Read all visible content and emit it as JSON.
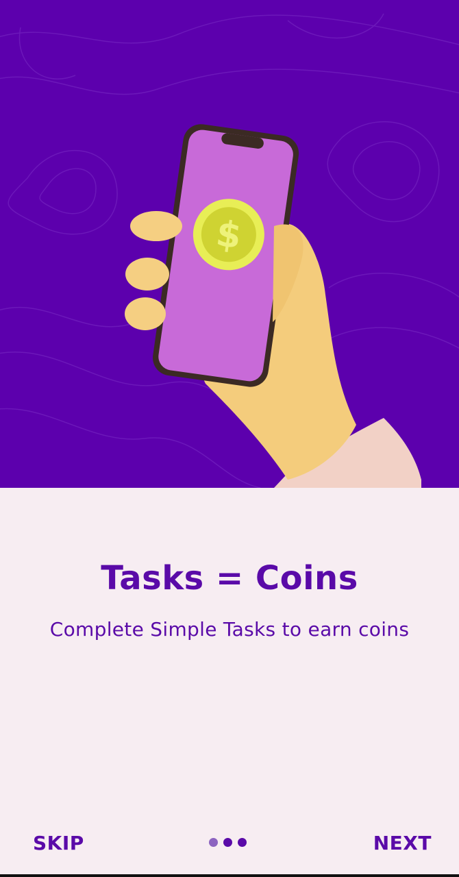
{
  "onboarding": {
    "title": "Tasks = Coins",
    "subtitle": "Complete Simple Tasks to earn coins",
    "page_indicator": {
      "current": 1,
      "total": 3
    }
  },
  "footer": {
    "skip_label": "SKIP",
    "next_label": "NEXT"
  },
  "illustration": {
    "icon": "hand-holding-phone-coin",
    "coin_symbol": "$"
  },
  "colors": {
    "hero_background": "#5c00ad",
    "screen_background": "#f7edf2",
    "text_accent": "#5a0aa8",
    "phone_screen": "#c86ad8",
    "coin": "#d6e03a"
  }
}
